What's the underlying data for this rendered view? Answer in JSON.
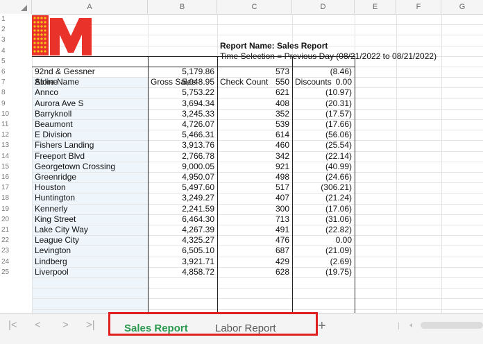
{
  "columns": [
    "A",
    "B",
    "C",
    "D",
    "E",
    "F",
    "G"
  ],
  "row_numbers": [
    "1",
    "2",
    "3",
    "4",
    "5",
    "6",
    "7",
    "8",
    "9",
    "10",
    "11",
    "12",
    "13",
    "14",
    "15",
    "16",
    "17",
    "18",
    "19",
    "20",
    "21",
    "22",
    "23",
    "24",
    "25"
  ],
  "report": {
    "name_label": "Report Name: Sales Report",
    "time_selection": "Time Selection = Previous Day (08/21/2022 to 08/21/2022)"
  },
  "table": {
    "headers": [
      "Store Name",
      "Gross Sales",
      "Check Count",
      "Discounts"
    ],
    "rows": [
      [
        "92nd & Gessner",
        "5,179.86",
        "573",
        "(8.46)"
      ],
      [
        "Airline",
        "5,048.95",
        "550",
        "0.00"
      ],
      [
        "Annco",
        "5,753.22",
        "621",
        "(10.97)"
      ],
      [
        "Aurora Ave S",
        "3,694.34",
        "408",
        "(20.31)"
      ],
      [
        "Barryknoll",
        "3,245.33",
        "352",
        "(17.57)"
      ],
      [
        "Beaumont",
        "4,726.07",
        "539",
        "(17.66)"
      ],
      [
        "E Division",
        "5,466.31",
        "614",
        "(56.06)"
      ],
      [
        "Fishers Landing",
        "3,913.76",
        "460",
        "(25.54)"
      ],
      [
        "Freeport Blvd",
        "2,766.78",
        "342",
        "(22.14)"
      ],
      [
        "Georgetown Crossing",
        "9,000.05",
        "921",
        "(40.99)"
      ],
      [
        "Greenridge",
        "4,950.07",
        "498",
        "(24.66)"
      ],
      [
        "Houston",
        "5,497.60",
        "517",
        "(306.21)"
      ],
      [
        "Huntington",
        "3,249.27",
        "407",
        "(21.24)"
      ],
      [
        "Kennerly",
        "2,241.59",
        "300",
        "(17.06)"
      ],
      [
        "King Street",
        "6,464.30",
        "713",
        "(31.06)"
      ],
      [
        "Lake City Way",
        "4,267.39",
        "491",
        "(22.82)"
      ],
      [
        "League City",
        "4,325.27",
        "476",
        "0.00"
      ],
      [
        "Levington",
        "6,505.10",
        "687",
        "(21.09)"
      ],
      [
        "Lindberg",
        "3,921.71",
        "429",
        "(2.69)"
      ],
      [
        "Liverpool",
        "4,858.72",
        "628",
        "(19.75)"
      ]
    ]
  },
  "tabs": {
    "active": "Sales Report",
    "other": "Labor Report",
    "add": "+"
  },
  "nav": {
    "first": "|<",
    "prev": "<",
    "next": ">",
    "last": ">|"
  },
  "colors": {
    "active_tab": "#2a9a4f",
    "highlight": "#e02020",
    "logo": "#e8322a",
    "logo_dots": "#f5c518"
  }
}
